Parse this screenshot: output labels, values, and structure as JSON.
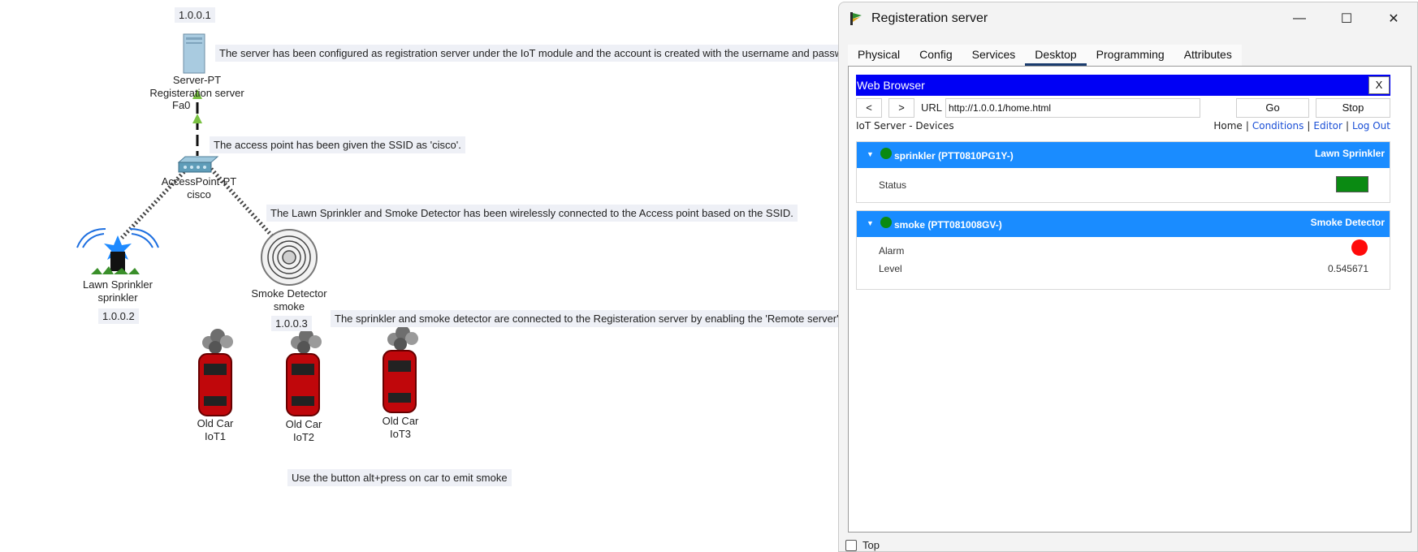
{
  "canvas": {
    "server": {
      "ip": "1.0.0.1",
      "type": "Server-PT",
      "name": "Registeration server",
      "port": "Fa0"
    },
    "access_point": {
      "type": "AccessPoint-PT",
      "ssid": "cisco"
    },
    "sprinkler": {
      "type": "Lawn Sprinkler",
      "name": "sprinkler",
      "ip": "1.0.0.2"
    },
    "smoke": {
      "type": "Smoke Detector",
      "name": "smoke",
      "ip": "1.0.0.3"
    },
    "cars": [
      {
        "type": "Old Car",
        "name": "IoT1"
      },
      {
        "type": "Old Car",
        "name": "IoT2"
      },
      {
        "type": "Old Car",
        "name": "IoT3"
      }
    ],
    "notes": {
      "server": "The server has been configured as registration server under the IoT module and the account is created with the username and passw",
      "ssid": "The access point has been given the SSID as 'cisco'.",
      "wireless": "The Lawn Sprinkler and Smoke Detector has been wirelessly connected to the Access point based on the SSID.",
      "remote": "The sprinkler and smoke detector are connected to the Registeration server by enabling the 'Remote server'",
      "smoke_tip": "Use the button alt+press on car to emit smoke"
    }
  },
  "window": {
    "title": "Registeration server",
    "controls": {
      "minimize": "—",
      "maximize": "☐",
      "close": "✕"
    },
    "tabs": [
      "Physical",
      "Config",
      "Services",
      "Desktop",
      "Programming",
      "Attributes"
    ],
    "active_tab": "Desktop",
    "top_checkbox_label": "Top"
  },
  "browser": {
    "title": "Web Browser",
    "close_label": "X",
    "back_label": "<",
    "forward_label": ">",
    "url_label": "URL",
    "url": "http://1.0.0.1/home.html",
    "go_label": "Go",
    "stop_label": "Stop",
    "page_title": "IoT Server - Devices",
    "links": {
      "home": "Home",
      "conditions": "Conditions",
      "editor": "Editor",
      "logout": "Log Out"
    },
    "devices": [
      {
        "name": "sprinkler (PTT0810PG1Y-)",
        "type": "Lawn Sprinkler",
        "fields": [
          {
            "label": "Status",
            "indicator": "green box"
          }
        ]
      },
      {
        "name": "smoke (PTT081008GV-)",
        "type": "Smoke Detector",
        "fields": [
          {
            "label": "Alarm",
            "indicator": "red dot"
          },
          {
            "label": "Level",
            "value": "0.545671"
          }
        ]
      }
    ]
  },
  "colors": {
    "browser_bar": "#0000f5",
    "device_header": "#1a8cff",
    "status_on": "#0a8a12",
    "alarm_on": "#ff0a0a",
    "link": "#1a4fd6",
    "note_bg": "#eef0f6"
  }
}
